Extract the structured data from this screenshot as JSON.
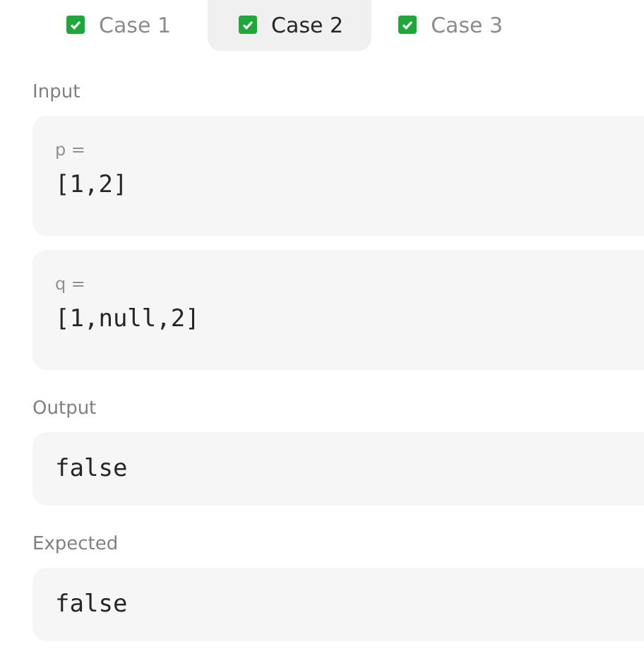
{
  "tabs": [
    {
      "label": "Case 1",
      "selected": false,
      "passed": true
    },
    {
      "label": "Case 2",
      "selected": true,
      "passed": true
    },
    {
      "label": "Case 3",
      "selected": false,
      "passed": true
    }
  ],
  "input": {
    "label": "Input",
    "params": [
      {
        "name": "p =",
        "value": "[1,2]"
      },
      {
        "name": "q =",
        "value": "[1,null,2]"
      }
    ]
  },
  "output": {
    "label": "Output",
    "value": "false"
  },
  "expected": {
    "label": "Expected",
    "value": "false"
  }
}
